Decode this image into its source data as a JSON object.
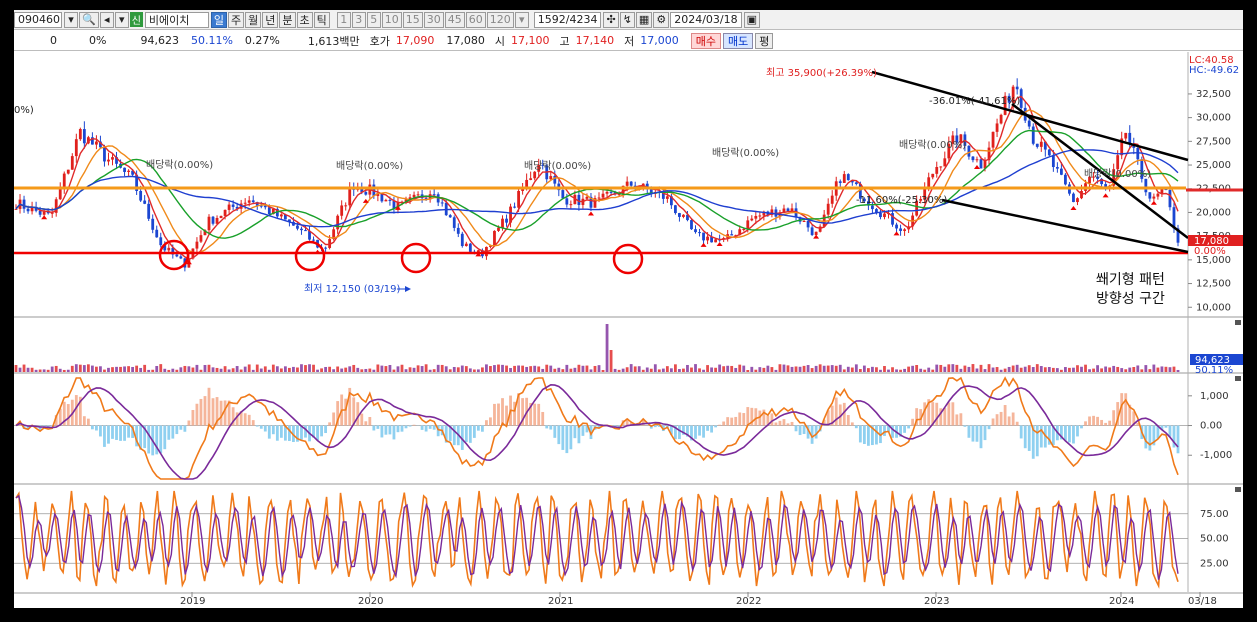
{
  "toolbar": {
    "code": "090460",
    "market_tag": "신",
    "stock_name": "비에이치",
    "periods": [
      "일",
      "주",
      "월",
      "년",
      "분",
      "초",
      "틱"
    ],
    "active_period": "일",
    "intervals": [
      "1",
      "3",
      "5",
      "10",
      "15",
      "30",
      "45",
      "60",
      "120"
    ],
    "count": "1592",
    "total": "/4234",
    "date": "2024/03/18"
  },
  "quote": {
    "change": "0",
    "change_pct": "0%",
    "volume": "94,623",
    "vol_ratio": "50.11%",
    "turnover_pct": "0.27%",
    "amount": "1,613백만",
    "ask_label": "호가",
    "ask": "17,090",
    "bid": "17,080",
    "open_label": "시",
    "open": "17,100",
    "high_label": "고",
    "high": "17,140",
    "low_label": "저",
    "low": "17,000",
    "buy_label": "매수",
    "sell_label": "매도",
    "pyeong_label": "평"
  },
  "colors": {
    "candle_up": "#e0201c",
    "candle_down": "#1b46d1",
    "ma_blue": "#1f3fd0",
    "ma_green": "#19a02a",
    "ma_orange": "#f08a1a",
    "ma_red": "#e02a2a",
    "line_purple": "#7a2a9a",
    "line_orange": "#f07a1a",
    "support": "#f00000",
    "resistance": "#f59a1a",
    "trend": "#000000"
  },
  "annotations": {
    "high": "최고 35,900(+26.39%)",
    "low": "최저 12,150 (03/19)",
    "dividends": [
      "배당락(0.00%)",
      "배당락(0.00%)",
      "배당락(0.00%)",
      "배당락(0.00%)",
      "배당락(0.00%)",
      "배당락(0.00%)"
    ],
    "pct_top": "-36.01%(-41.61%)",
    "pct_mid": "-11.60%(-25.30%)",
    "left_partial": "0%)",
    "pattern_line1": "쐐기형 패턴",
    "pattern_line2": "방향성 구간"
  },
  "right_axis": {
    "lc": "LC:40.58",
    "hc": "HC:-49.62",
    "current_price": "17,080",
    "current_pct": "0.00%",
    "volume_value": "94,623",
    "volume_pct": "50.11%"
  },
  "chart_data": [
    {
      "type": "candlestick",
      "title": "",
      "y_ticks": [
        "32,500",
        "30,000",
        "27,500",
        "25,000",
        "22,500",
        "20,000",
        "17,500",
        "15,000",
        "12,500",
        "10,000"
      ],
      "ylim": [
        9500,
        36500
      ],
      "x_ticks": [
        "2019",
        "2020",
        "2021",
        "2022",
        "2023",
        "2024",
        "03/18"
      ],
      "close_anchors": [
        {
          "t": 0.0,
          "v": 21000
        },
        {
          "t": 0.03,
          "v": 19500
        },
        {
          "t": 0.055,
          "v": 28500
        },
        {
          "t": 0.08,
          "v": 25500
        },
        {
          "t": 0.1,
          "v": 23500
        },
        {
          "t": 0.125,
          "v": 16500
        },
        {
          "t": 0.145,
          "v": 14500
        },
        {
          "t": 0.165,
          "v": 19000
        },
        {
          "t": 0.2,
          "v": 21500
        },
        {
          "t": 0.24,
          "v": 18500
        },
        {
          "t": 0.265,
          "v": 16000
        },
        {
          "t": 0.29,
          "v": 23000
        },
        {
          "t": 0.31,
          "v": 22000
        },
        {
          "t": 0.33,
          "v": 20500
        },
        {
          "t": 0.36,
          "v": 22500
        },
        {
          "t": 0.385,
          "v": 16500
        },
        {
          "t": 0.4,
          "v": 15500
        },
        {
          "t": 0.425,
          "v": 20000
        },
        {
          "t": 0.45,
          "v": 25500
        },
        {
          "t": 0.47,
          "v": 21500
        },
        {
          "t": 0.5,
          "v": 21000
        },
        {
          "t": 0.53,
          "v": 23000
        },
        {
          "t": 0.56,
          "v": 21500
        },
        {
          "t": 0.585,
          "v": 17500
        },
        {
          "t": 0.61,
          "v": 17000
        },
        {
          "t": 0.635,
          "v": 19500
        },
        {
          "t": 0.665,
          "v": 20500
        },
        {
          "t": 0.69,
          "v": 17500
        },
        {
          "t": 0.71,
          "v": 24000
        },
        {
          "t": 0.74,
          "v": 20500
        },
        {
          "t": 0.765,
          "v": 18000
        },
        {
          "t": 0.79,
          "v": 24500
        },
        {
          "t": 0.81,
          "v": 28000
        },
        {
          "t": 0.83,
          "v": 25000
        },
        {
          "t": 0.86,
          "v": 34000
        },
        {
          "t": 0.875,
          "v": 28000
        },
        {
          "t": 0.89,
          "v": 25500
        },
        {
          "t": 0.91,
          "v": 21000
        },
        {
          "t": 0.925,
          "v": 24000
        },
        {
          "t": 0.94,
          "v": 22000
        },
        {
          "t": 0.955,
          "v": 28500
        },
        {
          "t": 0.968,
          "v": 24000
        },
        {
          "t": 0.978,
          "v": 21000
        },
        {
          "t": 0.988,
          "v": 22500
        },
        {
          "t": 1.0,
          "v": 17080
        }
      ],
      "support_level": 15600,
      "resistance_level": 22000
    },
    {
      "type": "bar",
      "title": "volume",
      "note": "volume sub-panel"
    },
    {
      "type": "line",
      "title": "oscillator",
      "y_ticks": [
        "1,000",
        "0.00",
        "-1,000"
      ],
      "ylim": [
        -1800,
        1600
      ]
    },
    {
      "type": "line",
      "title": "stochastic",
      "y_ticks": [
        "75.00",
        "50.00",
        "25.00"
      ],
      "ylim": [
        0,
        100
      ]
    }
  ]
}
